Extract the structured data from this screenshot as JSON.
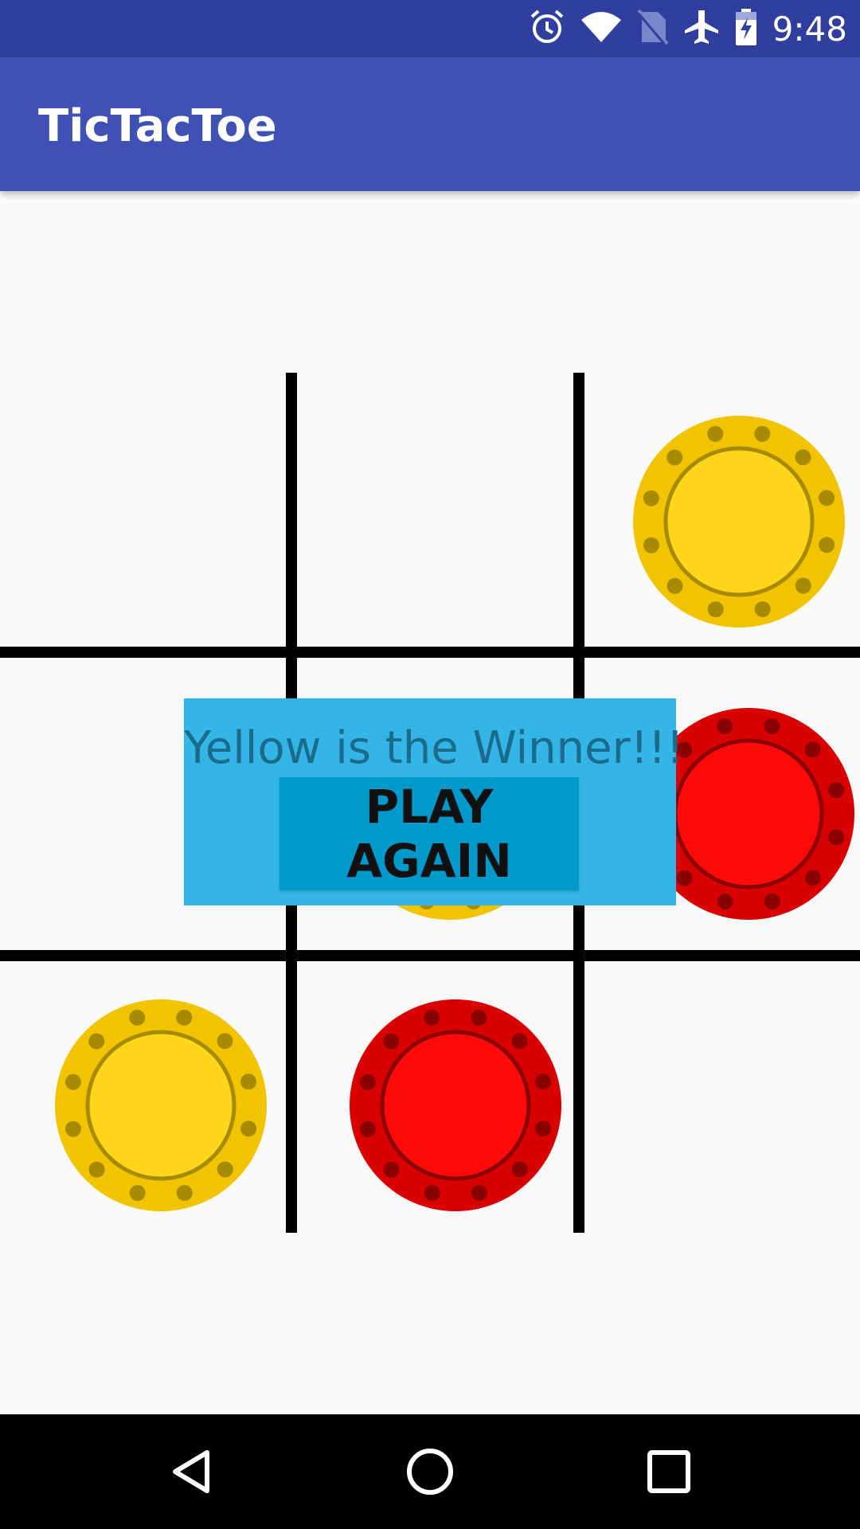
{
  "status_bar": {
    "time": "9:48",
    "icons": [
      "alarm-icon",
      "wifi-icon",
      "no-sim-icon",
      "airplane-icon",
      "battery-charging-icon"
    ]
  },
  "app_bar": {
    "title": "TicTacToe"
  },
  "board": {
    "cells": [
      "empty",
      "empty",
      "yellow",
      "empty",
      "yellow",
      "red",
      "yellow",
      "red",
      "empty"
    ]
  },
  "dialog": {
    "message": "Yellow is the Winner!!!",
    "button_label": "PLAY AGAIN"
  },
  "colors": {
    "status_bar": "#303f9f",
    "app_bar": "#3f51b5",
    "dialog": "#33b5e5",
    "button": "#0099cc",
    "yellow_chip": "#ffd61c",
    "red_chip": "#ff0a0a"
  },
  "nav_bar": {
    "icons": [
      "back-icon",
      "home-icon",
      "recents-icon"
    ]
  }
}
